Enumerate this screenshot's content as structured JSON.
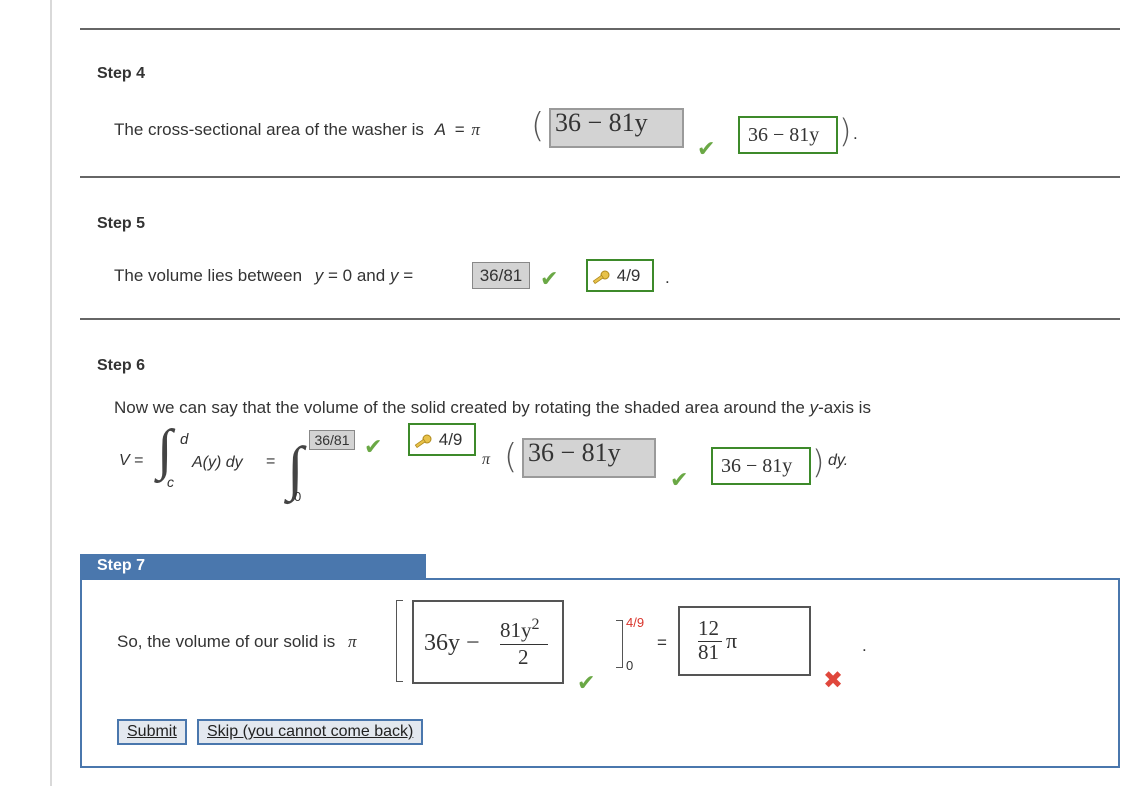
{
  "step4": {
    "title": "Step 4",
    "sentence": "The cross-sectional area of the washer is",
    "var": "A",
    "eq": "=",
    "pi": "π",
    "answer_gray": "36 − 81y",
    "answer_correct": "36 − 81y",
    "end": "."
  },
  "step5": {
    "title": "Step 5",
    "sentence_a": "The volume lies between",
    "y1": "y",
    "eq0": "= 0 and",
    "y2": "y",
    "eq": "=",
    "answer_gray": "36/81",
    "answer_correct": "4/9",
    "end": "."
  },
  "step6": {
    "title": "Step 6",
    "sentence": "Now we can say that the volume of the solid created by rotating the shaded area around the",
    "yaxis": "y",
    "sentence_end": "-axis is",
    "V": "V",
    "eq": "=",
    "upper_d": "d",
    "lower_c": "c",
    "Ay": "A(y) dy",
    "eq2": "=",
    "upper_gray": "36/81",
    "upper_correct": "4/9",
    "lower_0": "0",
    "pi": "π",
    "answer_gray": "36 − 81y",
    "answer_correct": "36 − 81y",
    "dy": "dy."
  },
  "step7": {
    "title": "Step 7",
    "sentence": "So, the volume of our solid is",
    "pi": "π",
    "integrand_a": "36y −",
    "frac_num": "81y",
    "frac_exp": "2",
    "frac_den": "2",
    "upper_limit": "4/9",
    "lower_limit": "0",
    "eq": "=",
    "result_num": "12",
    "result_den": "81",
    "result_pi": "π",
    "end": "."
  },
  "buttons": {
    "submit": "Submit",
    "skip": "Skip (you cannot come back)"
  },
  "colors": {
    "accent_blue": "#4a77ad",
    "correct_green": "#3d8a2a",
    "check_green": "#6aa845",
    "wrong_red": "#e0473c",
    "limit_red": "#d9342b"
  }
}
